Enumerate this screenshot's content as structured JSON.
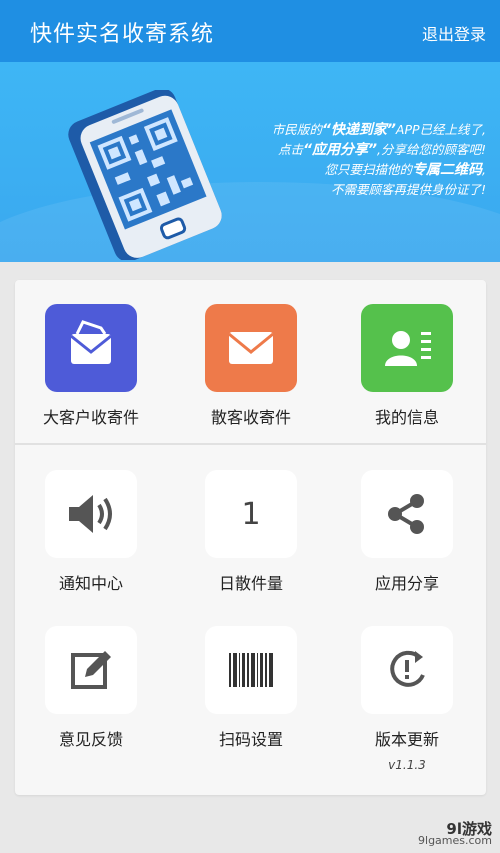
{
  "header": {
    "title": "快件实名收寄系统",
    "logout_label": "退出登录"
  },
  "banner": {
    "line1_pre": "市民版的",
    "line1_bold": "“快递到家”",
    "line1_post": "APP已经上线了,",
    "line2_pre": "点击",
    "line2_bold": "“应用分享”",
    "line2_post": ",分享给您的顾客吧!",
    "line3_pre": "您只要扫描他的",
    "line3_bold": "专属二维码",
    "line3_post": ",",
    "line4": "不需要顾客再提供身份证了!"
  },
  "top_tiles": [
    {
      "label": "大客户收寄件",
      "icon": "mail-open-icon",
      "color": "#4e5bd8"
    },
    {
      "label": "散客收寄件",
      "icon": "mail-icon",
      "color": "#ee7a4a"
    },
    {
      "label": "我的信息",
      "icon": "contact-card-icon",
      "color": "#55c14c"
    }
  ],
  "bottom_tiles": [
    {
      "label": "通知中心",
      "icon": "speaker-icon"
    },
    {
      "label": "日散件量",
      "icon": "count-badge",
      "value": "1"
    },
    {
      "label": "应用分享",
      "icon": "share-icon"
    },
    {
      "label": "意见反馈",
      "icon": "edit-icon"
    },
    {
      "label": "扫码设置",
      "icon": "barcode-icon"
    },
    {
      "label": "版本更新",
      "icon": "update-icon",
      "version": "v1.1.3"
    }
  ],
  "watermark": {
    "top": "9l游戏",
    "bottom": "9lgames.com"
  }
}
